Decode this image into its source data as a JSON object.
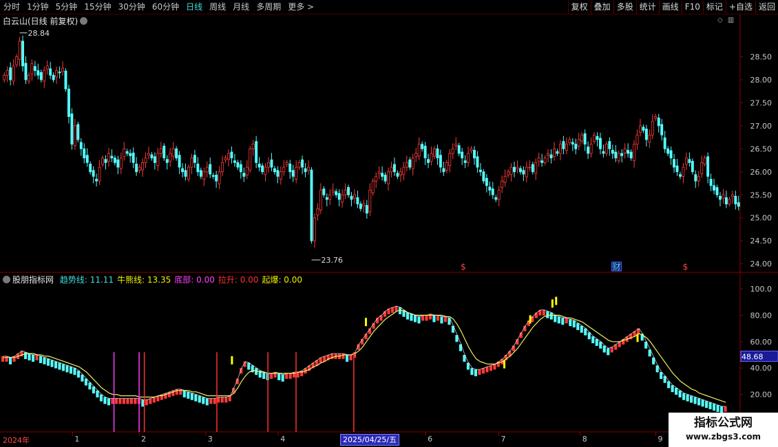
{
  "toolbar": {
    "left": [
      "分时",
      "1分钟",
      "5分钟",
      "15分钟",
      "30分钟",
      "60分钟",
      "日线",
      "周线",
      "月线",
      "多周期",
      "更多 >"
    ],
    "active_index": 6,
    "right": [
      "复权",
      "叠加",
      "多股",
      "统计",
      "画线",
      "F10",
      "标记",
      "+自选",
      "返回"
    ]
  },
  "stock": {
    "title": "白云山(日线 前复权)",
    "high_label": "28.84",
    "low_label": "23.76"
  },
  "indicator": {
    "name": "股朋指标网",
    "items": [
      {
        "label": "趋势线:",
        "value": "11.11",
        "color": "#3fdcdc"
      },
      {
        "label": "牛熊线:",
        "value": "13.35",
        "color": "#f0f000"
      },
      {
        "label": "底部:",
        "value": "0.00",
        "color": "#ff40ff"
      },
      {
        "label": "拉升:",
        "value": "0.00",
        "color": "#ff3030"
      },
      {
        "label": "起爆:",
        "value": "0.00",
        "color": "#f0f000"
      }
    ],
    "current_value": "48.68"
  },
  "price_axis": [
    "28.50",
    "28.00",
    "27.50",
    "27.00",
    "26.50",
    "26.00",
    "25.50",
    "25.00",
    "24.50",
    "24.00"
  ],
  "ind_axis": [
    "100.0",
    "80.00",
    "60.00",
    "40.00",
    "20.00"
  ],
  "x_labels": [
    {
      "text": "2024年",
      "pos": 0.0
    },
    {
      "text": "1",
      "pos": 0.098
    },
    {
      "text": "2",
      "pos": 0.188
    },
    {
      "text": "3",
      "pos": 0.278
    },
    {
      "text": "4",
      "pos": 0.376
    },
    {
      "text": "6",
      "pos": 0.575
    },
    {
      "text": "7",
      "pos": 0.674
    },
    {
      "text": "8",
      "pos": 0.784
    },
    {
      "text": "9",
      "pos": 0.886
    }
  ],
  "cursor_date": "2025/04/25/五",
  "markers": [
    {
      "text": "$",
      "pos": 0.626,
      "color": "#ff4040"
    },
    {
      "text": "财",
      "pos": 0.833,
      "color": "#3fdcdc",
      "boxed": true
    },
    {
      "text": "$",
      "pos": 0.926,
      "color": "#ff4040"
    }
  ],
  "watermark": {
    "line1": "指标公式网",
    "line2": "www.zbgs3.com"
  },
  "chart_data": {
    "type": "candlestick+indicator",
    "price_ylim": [
      23.76,
      28.84
    ],
    "indicator_ylim": [
      0,
      100
    ],
    "closes": [
      28.1,
      28.2,
      28.0,
      28.3,
      28.5,
      28.84,
      28.3,
      28.0,
      28.1,
      28.35,
      28.2,
      28.1,
      28.0,
      28.2,
      28.3,
      28.1,
      28.0,
      28.2,
      28.15,
      28.25,
      27.8,
      27.2,
      26.6,
      27.0,
      26.7,
      26.5,
      26.3,
      26.2,
      26.0,
      25.9,
      25.8,
      26.1,
      26.3,
      26.2,
      26.4,
      26.3,
      26.2,
      26.1,
      26.3,
      26.5,
      26.4,
      26.35,
      26.2,
      26.0,
      26.1,
      26.2,
      26.3,
      26.4,
      26.3,
      26.2,
      26.4,
      26.5,
      26.3,
      26.2,
      26.4,
      26.5,
      26.3,
      26.1,
      26.0,
      25.9,
      26.1,
      26.3,
      26.2,
      26.0,
      25.9,
      26.0,
      26.1,
      25.95,
      25.9,
      25.8,
      26.0,
      26.2,
      26.3,
      26.4,
      26.3,
      26.2,
      26.1,
      26.0,
      25.9,
      26.1,
      26.5,
      26.6,
      26.2,
      26.1,
      26.0,
      26.1,
      26.2,
      26.1,
      26.0,
      25.9,
      26.0,
      26.1,
      26.2,
      26.0,
      25.9,
      26.1,
      26.2,
      26.1,
      26.0,
      26.1,
      24.5,
      25.0,
      25.2,
      25.6,
      25.5,
      25.4,
      25.5,
      25.6,
      25.5,
      25.4,
      25.5,
      25.6,
      25.5,
      25.4,
      25.5,
      25.3,
      25.2,
      25.3,
      25.1,
      25.6,
      25.8,
      25.9,
      26.0,
      25.9,
      25.8,
      26.0,
      26.1,
      26.0,
      25.9,
      26.0,
      26.1,
      26.2,
      26.1,
      26.3,
      26.4,
      26.6,
      26.5,
      26.3,
      26.2,
      26.4,
      26.5,
      26.3,
      26.1,
      26.0,
      26.2,
      26.4,
      26.5,
      26.6,
      26.4,
      26.3,
      26.2,
      26.4,
      26.5,
      26.3,
      26.1,
      26.0,
      25.8,
      25.7,
      25.6,
      25.5,
      25.4,
      25.6,
      25.8,
      25.9,
      26.0,
      26.1,
      26.0,
      26.1,
      26.0,
      25.95,
      26.1,
      26.1,
      26.0,
      26.2,
      26.3,
      26.2,
      26.3,
      26.4,
      26.3,
      26.5,
      26.4,
      26.6,
      26.5,
      26.6,
      26.7,
      26.6,
      26.5,
      26.7,
      26.8,
      26.6,
      26.4,
      26.6,
      26.8,
      26.7,
      26.5,
      26.4,
      26.6,
      26.5,
      26.4,
      26.3,
      26.4,
      26.35,
      26.5,
      26.4,
      26.3,
      26.6,
      26.8,
      27.0,
      26.9,
      26.7,
      26.8,
      27.1,
      27.2,
      27.0,
      26.8,
      26.5,
      26.4,
      26.3,
      26.1,
      26.0,
      25.9,
      26.1,
      26.3,
      26.2,
      26.0,
      25.8,
      25.9,
      26.2,
      26.3,
      25.9,
      25.7,
      25.6,
      25.5,
      25.4,
      25.5,
      25.3,
      25.4,
      25.5,
      25.3,
      25.25
    ],
    "indicator_trend": [
      49,
      49,
      48,
      49,
      51,
      53,
      52,
      51,
      50,
      50,
      49,
      48,
      47,
      46,
      45,
      44,
      43,
      42,
      41,
      40,
      38,
      35,
      32,
      29,
      26,
      23,
      20,
      18,
      17,
      17,
      17,
      17,
      17,
      17,
      17,
      17,
      17,
      16,
      16,
      17,
      18,
      19,
      20,
      21,
      22,
      23,
      24,
      24,
      23,
      22,
      21,
      20,
      19,
      18,
      17,
      17,
      17,
      18,
      18,
      18,
      19,
      25,
      32,
      40,
      45,
      44,
      42,
      40,
      38,
      37,
      36,
      36,
      37,
      36,
      35,
      36,
      36,
      37,
      37,
      38,
      40,
      42,
      44,
      46,
      48,
      49,
      50,
      51,
      51,
      51,
      51,
      50,
      50,
      52,
      58,
      62,
      66,
      70,
      74,
      78,
      80,
      83,
      85,
      86,
      87,
      86,
      84,
      82,
      81,
      80,
      79,
      80,
      80,
      81,
      80,
      80,
      79,
      79,
      78,
      72,
      65,
      58,
      50,
      44,
      40,
      39,
      39,
      40,
      41,
      42,
      43,
      45,
      47,
      50,
      53,
      57,
      62,
      67,
      72,
      76,
      79,
      82,
      84,
      84,
      83,
      82,
      80,
      79,
      78,
      78,
      77,
      76,
      74,
      72,
      70,
      67,
      64,
      62,
      60,
      57,
      55,
      56,
      58,
      60,
      62,
      64,
      66,
      68,
      70,
      66,
      60,
      54,
      48,
      42,
      37,
      34,
      30,
      27,
      25,
      23,
      21,
      20,
      19,
      18,
      17,
      16,
      15,
      14,
      13,
      12,
      11,
      11
    ],
    "indicator_bull": [
      48,
      48,
      48,
      48,
      49,
      50,
      51,
      51,
      51,
      50,
      50,
      49,
      49,
      48,
      47,
      46,
      45,
      44,
      43,
      42,
      41,
      39,
      37,
      34,
      31,
      28,
      25,
      23,
      21,
      20,
      20,
      19,
      19,
      19,
      19,
      19,
      18,
      18,
      18,
      18,
      18,
      19,
      19,
      20,
      21,
      22,
      23,
      23,
      23,
      23,
      22,
      22,
      21,
      20,
      19,
      19,
      19,
      19,
      19,
      19,
      19,
      21,
      25,
      30,
      34,
      37,
      38,
      38,
      37,
      37,
      36,
      36,
      36,
      36,
      36,
      36,
      36,
      36,
      37,
      37,
      38,
      39,
      41,
      42,
      44,
      45,
      47,
      48,
      49,
      49,
      50,
      50,
      50,
      51,
      53,
      56,
      60,
      64,
      68,
      71,
      74,
      77,
      79,
      81,
      83,
      84,
      83,
      82,
      81,
      80,
      80,
      80,
      80,
      80,
      80,
      80,
      80,
      79,
      79,
      77,
      73,
      68,
      62,
      56,
      51,
      47,
      45,
      44,
      43,
      43,
      43,
      44,
      45,
      47,
      49,
      52,
      55,
      59,
      63,
      67,
      71,
      74,
      77,
      79,
      80,
      80,
      80,
      80,
      79,
      78,
      78,
      77,
      76,
      75,
      73,
      71,
      69,
      67,
      65,
      63,
      61,
      60,
      60,
      60,
      61,
      62,
      63,
      64,
      66,
      65,
      63,
      60,
      56,
      52,
      48,
      44,
      40,
      36,
      33,
      30,
      28,
      26,
      24,
      23,
      21,
      20,
      19,
      18,
      17,
      16,
      15,
      14,
      13
    ]
  }
}
